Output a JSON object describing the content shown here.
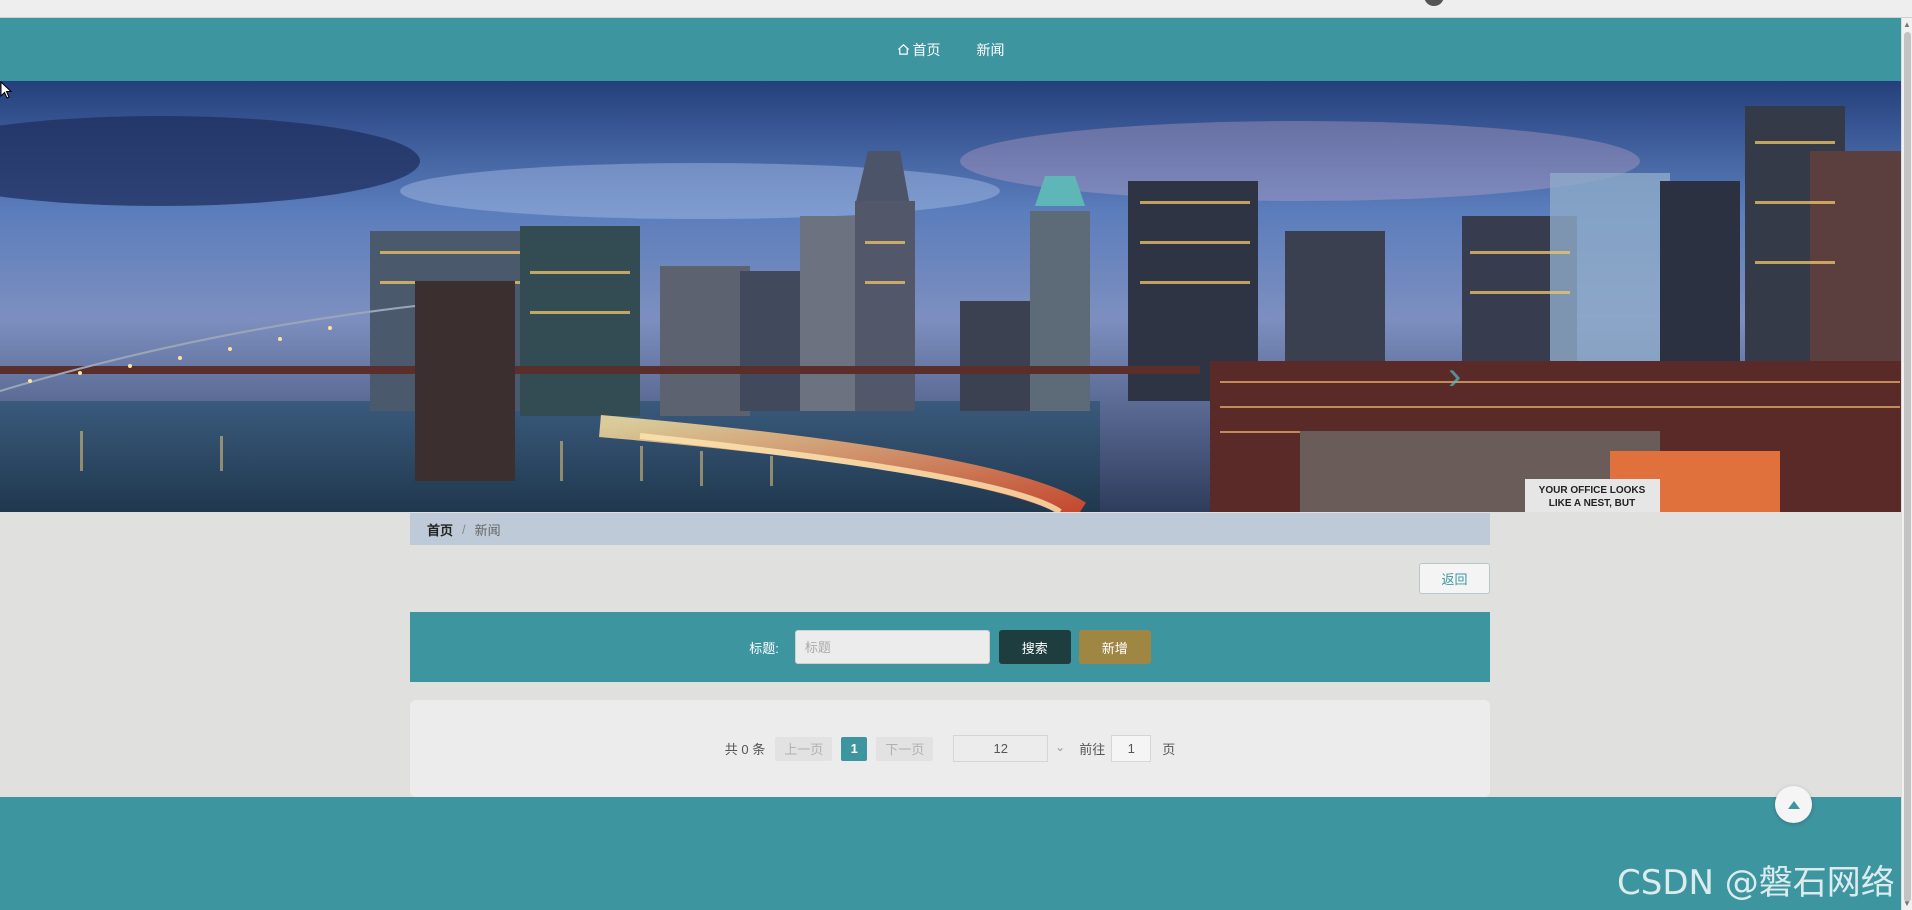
{
  "nav": {
    "items": [
      {
        "label": "首页",
        "icon": "home-icon"
      },
      {
        "label": "新闻"
      }
    ]
  },
  "banner": {
    "sign_line1": "YOUR OFFICE LOOKS",
    "sign_line2": "LIKE A NEST, BUT"
  },
  "breadcrumb": {
    "home": "首页",
    "separator": "/",
    "current": "新闻"
  },
  "actions": {
    "back_label": "返回"
  },
  "search": {
    "label": "标题:",
    "placeholder": "标题",
    "search_button": "搜索",
    "add_button": "新增"
  },
  "pagination": {
    "total": "共 0 条",
    "prev": "上一页",
    "current_page": "1",
    "next": "下一页",
    "page_size": "12",
    "goto_label": "前往",
    "goto_value": "1",
    "page_suffix": "页"
  },
  "watermark": "CSDN @磐石网络",
  "colors": {
    "primary": "#3d95a0",
    "search_button": "#1e3d3e",
    "add_button": "#a08643",
    "breadcrumb_bg": "#bfcad8"
  }
}
